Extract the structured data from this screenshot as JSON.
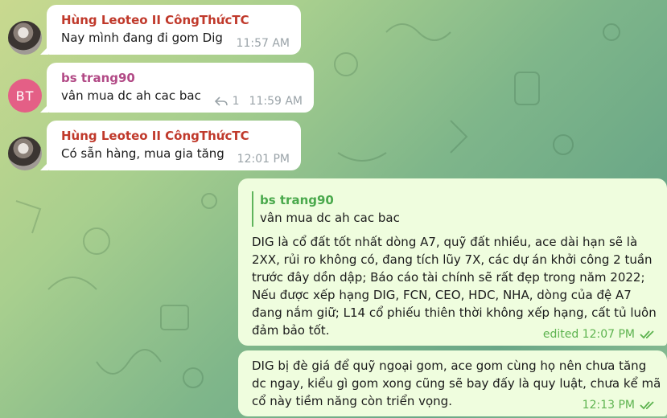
{
  "messages": [
    {
      "sender": "Hùng Leoteo II CôngThứcTC",
      "sender_color": "#c0392b",
      "text": "Nay mình đang đi gom Dig",
      "time": "11:57 AM",
      "avatar_icon": "user-photo-icon"
    },
    {
      "sender": "bs trang90",
      "sender_color": "#b24a86",
      "text": "vân mua dc ah cac bac",
      "reply_count": "1",
      "time": "11:59 AM",
      "avatar_initials": "BT",
      "avatar_color": "#e45f86"
    },
    {
      "sender": "Hùng Leoteo II CôngThứcTC",
      "sender_color": "#c0392b",
      "text": "Có sẵn hàng, mua gia tăng",
      "time": "12:01 PM",
      "avatar_icon": "user-photo-icon"
    }
  ],
  "outgoing": [
    {
      "quote_name": "bs trang90",
      "quote_text": "vân mua dc ah cac bac",
      "lines": [
        "DIG là cổ đất tốt nhất dòng A7, quỹ đất nhiều, ace dài hạn sẽ là",
        "2XX, rủi ro không có, đang tích lũy 7X, các dự án khởi công 2 tuần",
        "trước đây dồn dập; Báo cáo tài chính sẽ rất đẹp trong năm 2022;",
        "Nếu được xếp hạng DIG, FCN, CEO, HDC,  NHA,  dòng của đệ A7",
        "đang nắm giữ;  L14 cổ phiếu thiên thời không xếp hạng, cất tủ luôn",
        "đảm bảo tốt."
      ],
      "status": "edited 12:07 PM"
    },
    {
      "lines": [
        "DIG bị đè giá để quỹ ngoại gom, ace gom cùng họ nên chưa tăng",
        "dc ngay, kiểu gì gom xong cũng sẽ bay đấy là quy luật, chưa kể mã",
        "cổ này tiềm năng còn triển vọng."
      ],
      "status": "12:13 PM"
    }
  ],
  "colors": {
    "incoming_bubble": "#ffffff",
    "outgoing_bubble": "#effdde",
    "read_check": "#5db34f"
  }
}
